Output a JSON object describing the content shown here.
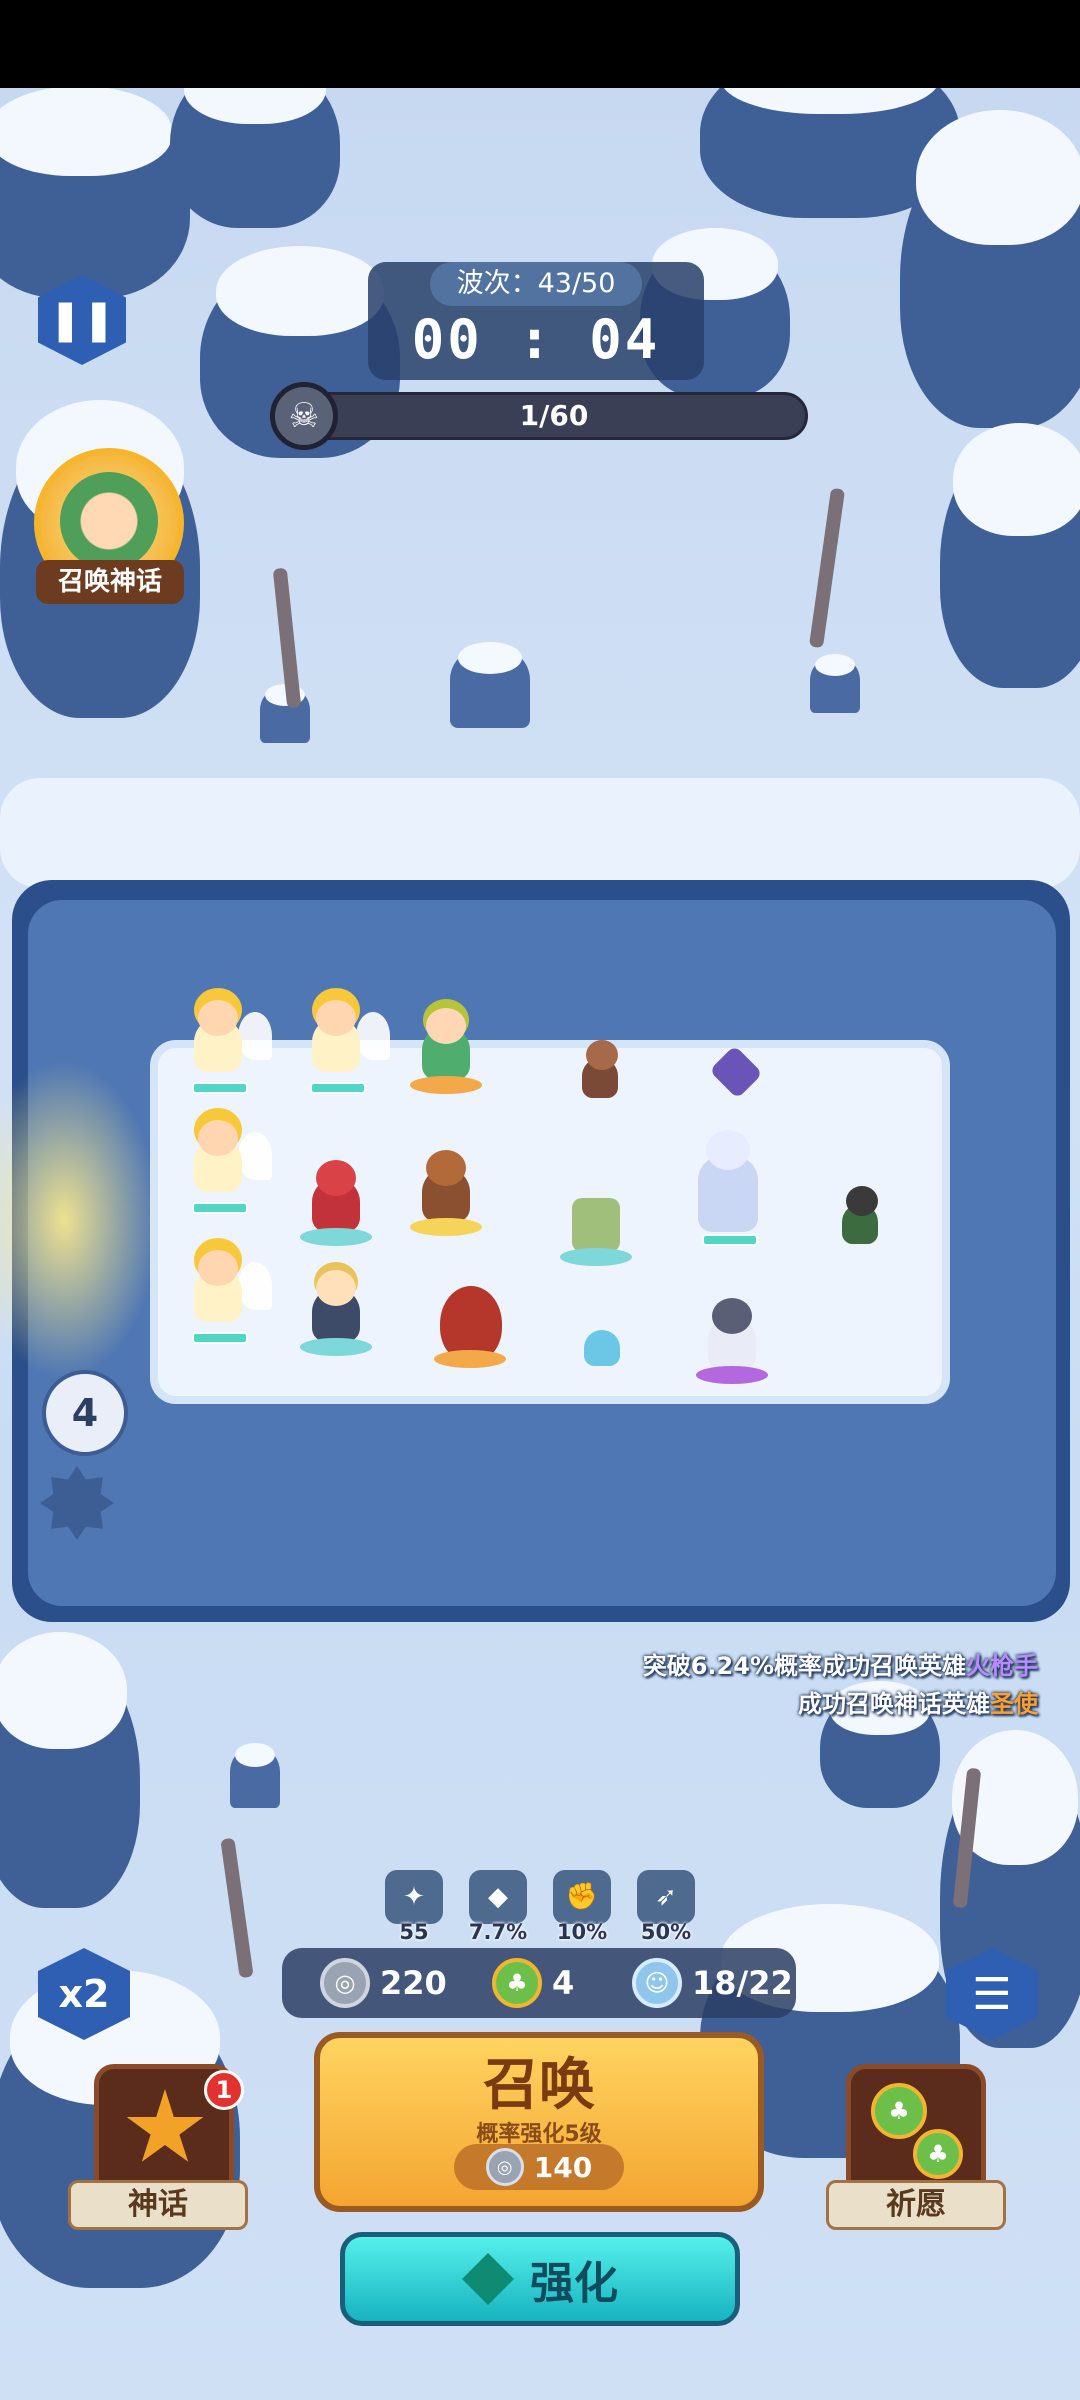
{
  "hud": {
    "wave_label": "波次：43/50",
    "timer": "00 : 04",
    "kill_progress": "1/60",
    "pause_icon": "pause-icon",
    "skull_icon": "skull-icon"
  },
  "summon_myth": {
    "label": "召唤神话"
  },
  "arena": {
    "wave_counter": "4"
  },
  "messages": [
    {
      "prefix": "突破6.24%概率成功召唤英雄",
      "highlight": "火枪手",
      "highlight_color": "#b88cff"
    },
    {
      "prefix": "成功召唤神话英雄",
      "highlight": "圣使",
      "highlight_color": "#ffa02e"
    }
  ],
  "buffs": [
    {
      "icon": "attack-buff-icon",
      "value": "55"
    },
    {
      "icon": "crit-buff-icon",
      "value": "7.7%"
    },
    {
      "icon": "power-buff-icon",
      "value": "10%"
    },
    {
      "icon": "speed-buff-icon",
      "value": "50%"
    }
  ],
  "resources": {
    "silver": "220",
    "clover": "4",
    "population": "18/22"
  },
  "buttons": {
    "speed": "x2",
    "menu_icon": "menu-icon",
    "summon_title": "召唤",
    "summon_subtitle": "概率强化5级",
    "summon_cost": "140",
    "enhance": "强化",
    "myth_label": "神话",
    "myth_badge": "1",
    "pray_label": "祈愿"
  }
}
